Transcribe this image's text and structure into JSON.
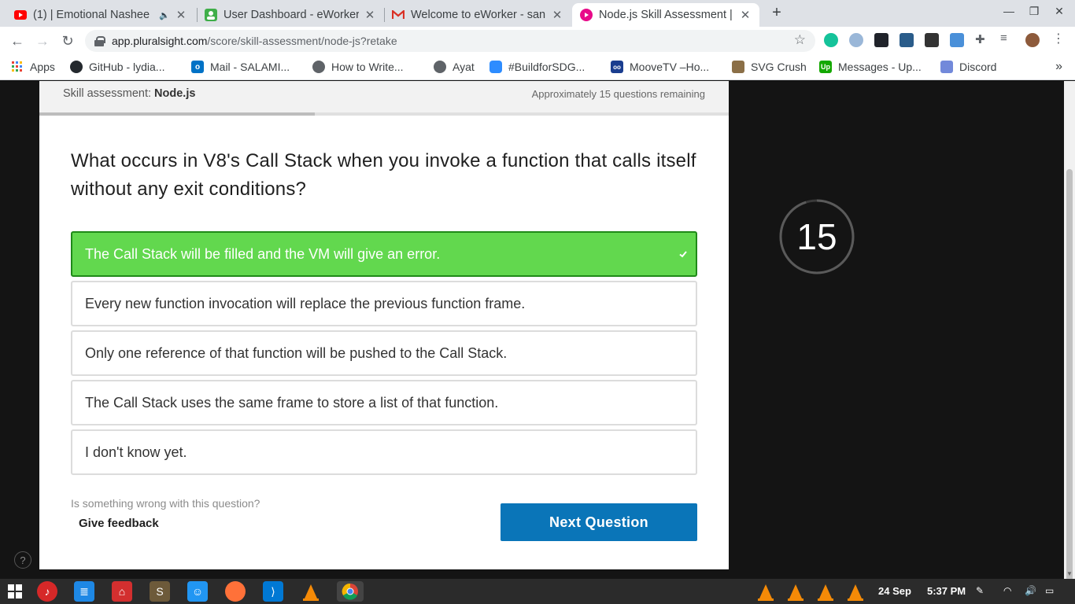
{
  "browser": {
    "tabs": [
      {
        "title": "(1) | Emotional Nashee",
        "favicon": "youtube-icon",
        "muted_icon": "speaker-icon"
      },
      {
        "title": "User Dashboard - eWorker",
        "favicon": "eworker-icon"
      },
      {
        "title": "Welcome to eWorker - san",
        "favicon": "gmail-icon"
      },
      {
        "title": "Node.js Skill Assessment |",
        "favicon": "pluralsight-icon"
      }
    ],
    "url_host": "app.pluralsight.com",
    "url_path": "/score/skill-assessment/node-js?retake",
    "bookmarks": [
      {
        "label": "Apps",
        "icon": "apps-grid-icon"
      },
      {
        "label": "GitHub - lydia...",
        "icon": "github-icon"
      },
      {
        "label": "Mail - SALAMI...",
        "icon": "outlook-icon"
      },
      {
        "label": "How to Write...",
        "icon": "globe-icon"
      },
      {
        "label": "Ayat",
        "icon": "globe-icon"
      },
      {
        "label": "#BuildforSDG...",
        "icon": "zoom-icon"
      },
      {
        "label": "MooveTV –Ho...",
        "icon": "moovetv-icon"
      },
      {
        "label": "SVG Crush",
        "icon": "svgcrush-icon"
      },
      {
        "label": "Messages - Up...",
        "icon": "upwork-icon"
      },
      {
        "label": "Discord",
        "icon": "discord-icon"
      }
    ]
  },
  "assessment": {
    "header_prefix": "Skill assessment: ",
    "header_subject": "Node.js",
    "remaining": "Approximately 15 questions remaining",
    "progress": 0.4,
    "question": "What occurs in V8's Call Stack when you invoke a function that calls itself without any exit conditions?",
    "options": [
      {
        "text": "The Call Stack will be filled and the VM will give an error.",
        "selected": true
      },
      {
        "text": "Every new function invocation will replace the previous function frame.",
        "selected": false
      },
      {
        "text": "Only one reference of that function will be pushed to the Call Stack.",
        "selected": false
      },
      {
        "text": "The Call Stack uses the same frame to store a list of that function.",
        "selected": false
      },
      {
        "text": "I don't know yet.",
        "selected": false
      }
    ],
    "feedback_question": "Is something wrong with this question?",
    "feedback_link": "Give feedback",
    "next_button": "Next Question",
    "timer": "15",
    "timer_fraction": 0.95,
    "help": "?"
  },
  "taskbar": {
    "date": "24 Sep",
    "time": "5:37 PM"
  },
  "colors": {
    "correct_bg": "#62d84e",
    "correct_border": "#1f8a18",
    "next_button": "#0a75b8",
    "page_bg": "#141414"
  }
}
